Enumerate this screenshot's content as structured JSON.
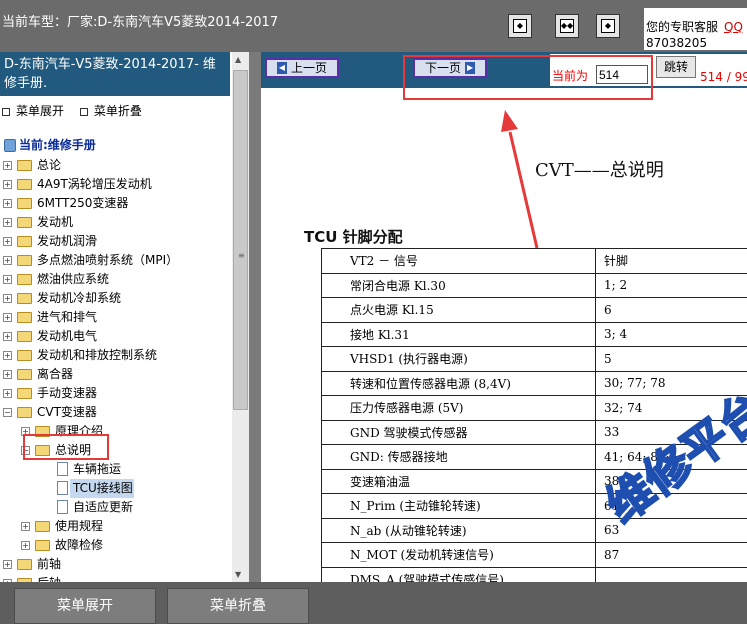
{
  "header": {
    "title": "当前车型：厂家:D-东南汽车V5菱致2014-2017",
    "service_text": "您的专职客服",
    "service_qq": "QQ",
    "service_number": "87038205",
    "buttons": [
      "first-page-icon",
      "fit-width-icon",
      "last-page-icon"
    ]
  },
  "sidebar": {
    "title": "D-东南汽车-V5菱致-2014-2017- 维修手册.",
    "expand_label": "菜单展开",
    "collapse_label": "菜单折叠",
    "root_label": "当前:维修手册",
    "nodes": [
      {
        "label": "总论"
      },
      {
        "label": "4A9T涡轮增压发动机"
      },
      {
        "label": "6MTT250变速器"
      },
      {
        "label": "发动机"
      },
      {
        "label": "发动机润滑"
      },
      {
        "label": "多点燃油喷射系统（MPI）"
      },
      {
        "label": "燃油供应系统"
      },
      {
        "label": "发动机冷却系统"
      },
      {
        "label": "进气和排气"
      },
      {
        "label": "发动机电气"
      },
      {
        "label": "发动机和排放控制系统"
      },
      {
        "label": "离合器"
      },
      {
        "label": "手动变速器"
      },
      {
        "label": "CVT变速器"
      },
      {
        "label": "原理介绍"
      },
      {
        "label": "总说明"
      },
      {
        "label": "车辆拖运"
      },
      {
        "label": "TCU接线图"
      },
      {
        "label": "自适应更新"
      },
      {
        "label": "使用规程"
      },
      {
        "label": "故障检修"
      },
      {
        "label": "前轴"
      },
      {
        "label": "后轴"
      }
    ]
  },
  "content": {
    "prev_label": "上一页",
    "next_label": "下一页",
    "current_label": "当前为",
    "current_value": "514",
    "jump_label": "跳转",
    "page_count": "514 / 99",
    "doc_title": "CVT——总说明",
    "doc_subtitle": "TCU 针脚分配",
    "table_header": [
      "VT2 － 信号",
      "针脚"
    ],
    "table_rows": [
      [
        "常闭合电源 Kl.30",
        "1; 2"
      ],
      [
        "点火电源 Kl.15",
        "6"
      ],
      [
        "接地 Kl.31",
        "3; 4"
      ],
      [
        "VHSD1 (执行器电源)",
        "5"
      ],
      [
        "转速和位置传感器电源 (8,4V)",
        "30; 77; 78"
      ],
      [
        "压力传感器电源 (5V)",
        "32; 74"
      ],
      [
        "GND 驾驶模式传感器",
        "33"
      ],
      [
        "GND: 传感器接地",
        "41; 64; 86;"
      ],
      [
        "变速箱油温",
        "38"
      ],
      [
        "N_Prim (主动锥轮转速)",
        "61"
      ],
      [
        "N_ab (从动锥轮转速)",
        "63"
      ],
      [
        "N_MOT (发动机转速信号)",
        "87"
      ],
      [
        "DMS_A (驾驶模式传感信号)",
        ""
      ]
    ],
    "watermark": "维修平台"
  },
  "footer": {
    "expand_label": "菜单展开",
    "collapse_label": "菜单折叠"
  },
  "colors": {
    "accent": "#215a7e",
    "annotation": "#e63a3a"
  }
}
